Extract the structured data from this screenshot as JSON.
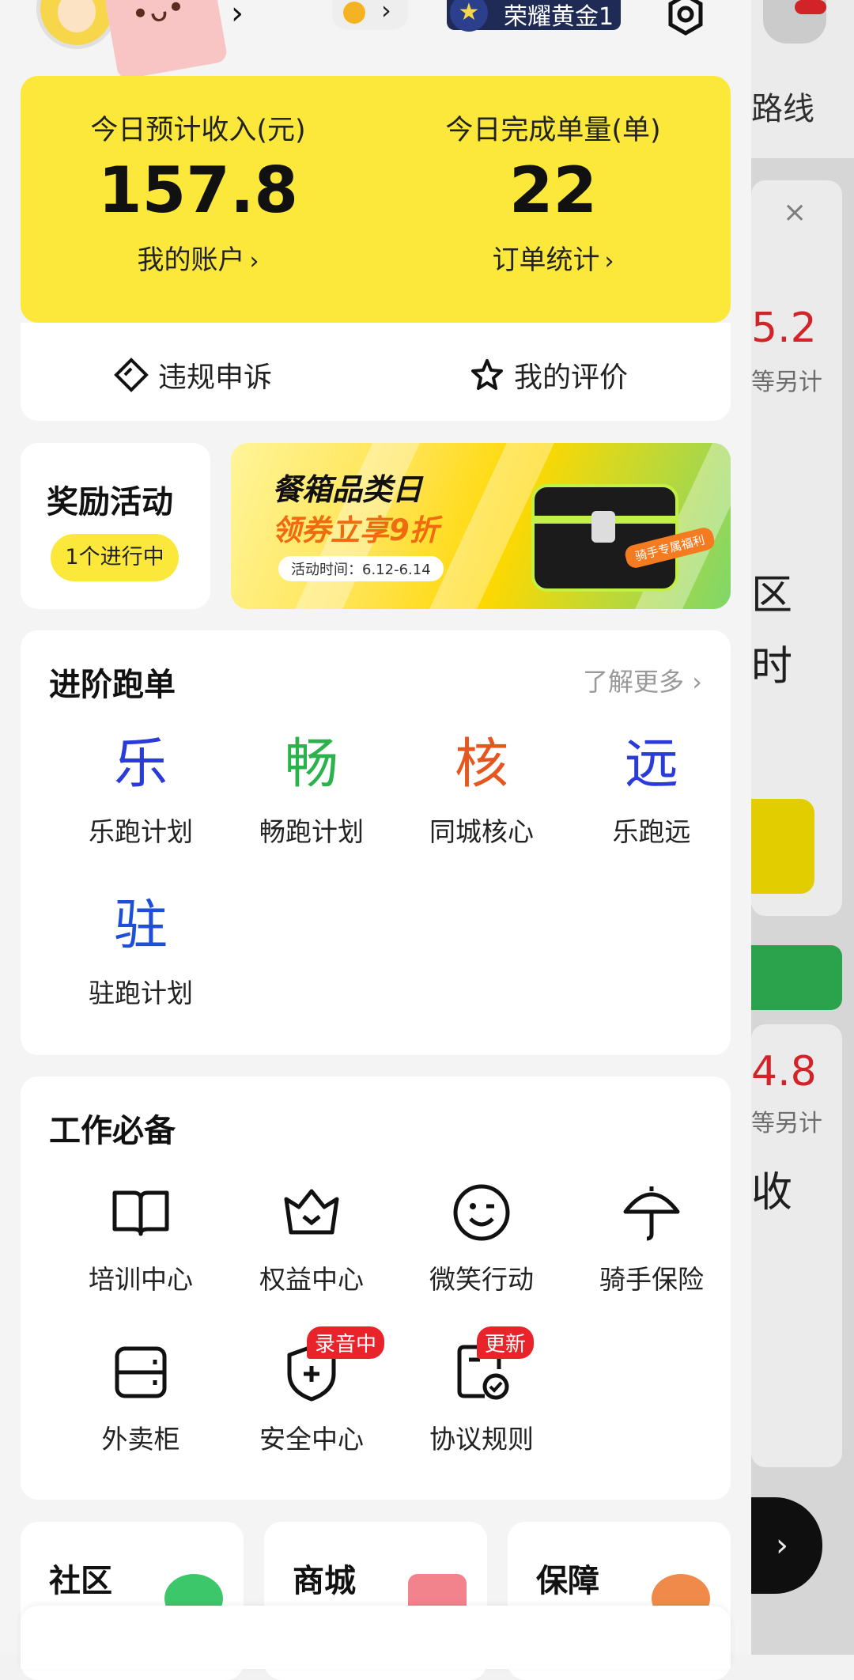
{
  "header": {
    "arrow": "›",
    "coin_arrow": "›",
    "rank_label": "荣耀黄金1"
  },
  "income": {
    "left_label": "今日预计收入(元)",
    "left_value": "157.8",
    "left_link": "我的账户",
    "right_label": "今日完成单量(单)",
    "right_value": "22",
    "right_link": "订单统计",
    "link_arrow": "›"
  },
  "quick_links": {
    "appeal": "违规申诉",
    "review": "我的评价"
  },
  "reward": {
    "title": "奖励活动",
    "status": "1个进行中"
  },
  "banner": {
    "headline": "餐箱品类日",
    "subline": "领券立享9折",
    "date": "活动时间：6.12-6.14",
    "tag": "骑手专属福利"
  },
  "advanced": {
    "title": "进阶跑单",
    "more": "了解更多 ›",
    "items": [
      {
        "glyph": "乐",
        "label": "乐跑计划",
        "color": "#2a3bd8"
      },
      {
        "glyph": "畅",
        "label": "畅跑计划",
        "color": "#2bb24c"
      },
      {
        "glyph": "核",
        "label": "同城核心",
        "color": "#e6561f"
      },
      {
        "glyph": "远",
        "label": "乐跑远",
        "color": "#2a3bd8"
      },
      {
        "glyph": "驻",
        "label": "驻跑计划",
        "color": "#1f4fd6"
      }
    ]
  },
  "tools": {
    "title": "工作必备",
    "items": [
      {
        "label": "培训中心",
        "icon": "book-icon"
      },
      {
        "label": "权益中心",
        "icon": "crown-icon"
      },
      {
        "label": "微笑行动",
        "icon": "smile-icon"
      },
      {
        "label": "骑手保险",
        "icon": "umbrella-icon"
      },
      {
        "label": "外卖柜",
        "icon": "locker-icon"
      },
      {
        "label": "安全中心",
        "icon": "shield-icon",
        "badge": "录音中"
      },
      {
        "label": "协议规则",
        "icon": "document-check-icon",
        "badge": "更新"
      }
    ]
  },
  "mini_cards": [
    {
      "title": "社区",
      "icon": "chat-icon",
      "color": "#3cc76a"
    },
    {
      "title": "商城",
      "icon": "gift-icon",
      "color": "#f2828c"
    },
    {
      "title": "保障",
      "icon": "heart-icon",
      "color": "#f08a4b"
    }
  ],
  "background_page": {
    "route": "路线",
    "close": "×",
    "num1": "5.2",
    "note1": "等另计",
    "text1": "区",
    "text2": "时",
    "num2": "4.8",
    "note2": "等另计",
    "text3": "收",
    "go": "›"
  }
}
